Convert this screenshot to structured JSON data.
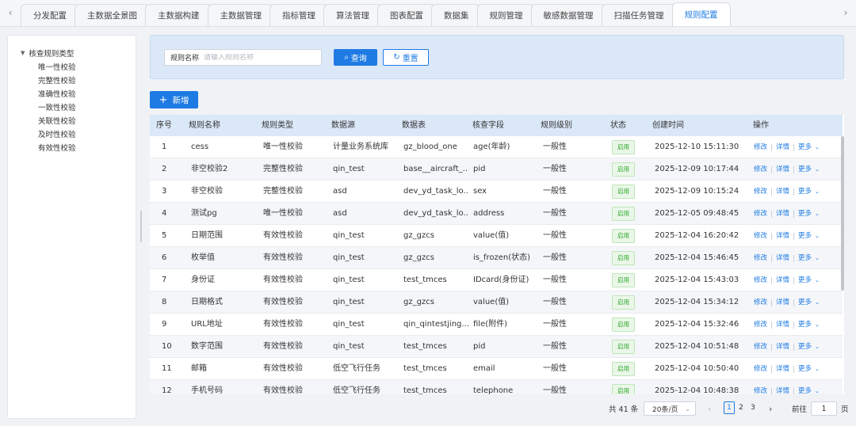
{
  "tabs": [
    {
      "label": "分发配置",
      "active": false
    },
    {
      "label": "主数据全景图",
      "active": false
    },
    {
      "label": "主数据构建",
      "active": false
    },
    {
      "label": "主数据管理",
      "active": false
    },
    {
      "label": "指标管理",
      "active": false
    },
    {
      "label": "算法管理",
      "active": false
    },
    {
      "label": "图表配置",
      "active": false
    },
    {
      "label": "数据集",
      "active": false
    },
    {
      "label": "规则管理",
      "active": false
    },
    {
      "label": "敏感数据管理",
      "active": false
    },
    {
      "label": "扫描任务管理",
      "active": false
    },
    {
      "label": "规则配置",
      "active": true
    }
  ],
  "tree": {
    "root": "核查规则类型",
    "children": [
      "唯一性校验",
      "完整性校验",
      "准确性校验",
      "一致性校验",
      "关联性校验",
      "及时性校验",
      "有效性校验"
    ]
  },
  "search": {
    "label": "规则名称",
    "placeholder": "请输入规则名称",
    "query_label": "查询",
    "reset_label": "重置"
  },
  "add_label": "新增",
  "table": {
    "columns": [
      "序号",
      "规则名称",
      "规则类型",
      "数据源",
      "数据表",
      "核查字段",
      "规则级别",
      "状态",
      "创建时间",
      "操作"
    ],
    "status_label": "启用",
    "ops": {
      "edit": "修改",
      "detail": "详情",
      "more": "更多"
    },
    "rows": [
      {
        "no": "1",
        "name": "cess",
        "type": "唯一性校验",
        "source": "计量业务系统库",
        "table": "gz_blood_one",
        "field": "age(年龄)",
        "level": "一般性",
        "created": "2025-12-10 15:11:30"
      },
      {
        "no": "2",
        "name": "非空校验2",
        "type": "完整性校验",
        "source": "qin_test",
        "table": "base__aircraft_...",
        "field": "pid",
        "level": "一般性",
        "created": "2025-12-09 10:17:44"
      },
      {
        "no": "3",
        "name": "非空校验",
        "type": "完整性校验",
        "source": "asd",
        "table": "dev_yd_task_lo...",
        "field": "sex",
        "level": "一般性",
        "created": "2025-12-09 10:15:24"
      },
      {
        "no": "4",
        "name": "测试pg",
        "type": "唯一性校验",
        "source": "asd",
        "table": "dev_yd_task_lo...",
        "field": "address",
        "level": "一般性",
        "created": "2025-12-05 09:48:45"
      },
      {
        "no": "5",
        "name": "日期范围",
        "type": "有效性校验",
        "source": "qin_test",
        "table": "gz_gzcs",
        "field": "value(值)",
        "level": "一般性",
        "created": "2025-12-04 16:20:42"
      },
      {
        "no": "6",
        "name": "枚举值",
        "type": "有效性校验",
        "source": "qin_test",
        "table": "gz_gzcs",
        "field": "is_frozen(状态)",
        "level": "一般性",
        "created": "2025-12-04 15:46:45"
      },
      {
        "no": "7",
        "name": "身份证",
        "type": "有效性校验",
        "source": "qin_test",
        "table": "test_tmces",
        "field": "IDcard(身份证)",
        "level": "一般性",
        "created": "2025-12-04 15:43:03"
      },
      {
        "no": "8",
        "name": "日期格式",
        "type": "有效性校验",
        "source": "qin_test",
        "table": "gz_gzcs",
        "field": "value(值)",
        "level": "一般性",
        "created": "2025-12-04 15:34:12"
      },
      {
        "no": "9",
        "name": "URL地址",
        "type": "有效性校验",
        "source": "qin_test",
        "table": "qin_qintestjing...",
        "field": "file(附件)",
        "level": "一般性",
        "created": "2025-12-04 15:32:46"
      },
      {
        "no": "10",
        "name": "数字范围",
        "type": "有效性校验",
        "source": "qin_test",
        "table": "test_tmces",
        "field": "pid",
        "level": "一般性",
        "created": "2025-12-04 10:51:48"
      },
      {
        "no": "11",
        "name": "邮箱",
        "type": "有效性校验",
        "source": "低空飞行任务",
        "table": "test_tmces",
        "field": "email",
        "level": "一般性",
        "created": "2025-12-04 10:50:40"
      },
      {
        "no": "12",
        "name": "手机号码",
        "type": "有效性校验",
        "source": "低空飞行任务",
        "table": "test_tmces",
        "field": "telephone",
        "level": "一般性",
        "created": "2025-12-04 10:48:38"
      }
    ]
  },
  "pagination": {
    "total": "共 41 条",
    "page_size": "20条/页",
    "pages": [
      "1",
      "2",
      "3"
    ],
    "current": "1",
    "goto_label": "前往",
    "goto_value": "1",
    "page_unit": "页"
  },
  "colors": {
    "accent": "#1e7be4",
    "header_bg": "#dbe8f8",
    "status_green": "#2aa52a"
  }
}
